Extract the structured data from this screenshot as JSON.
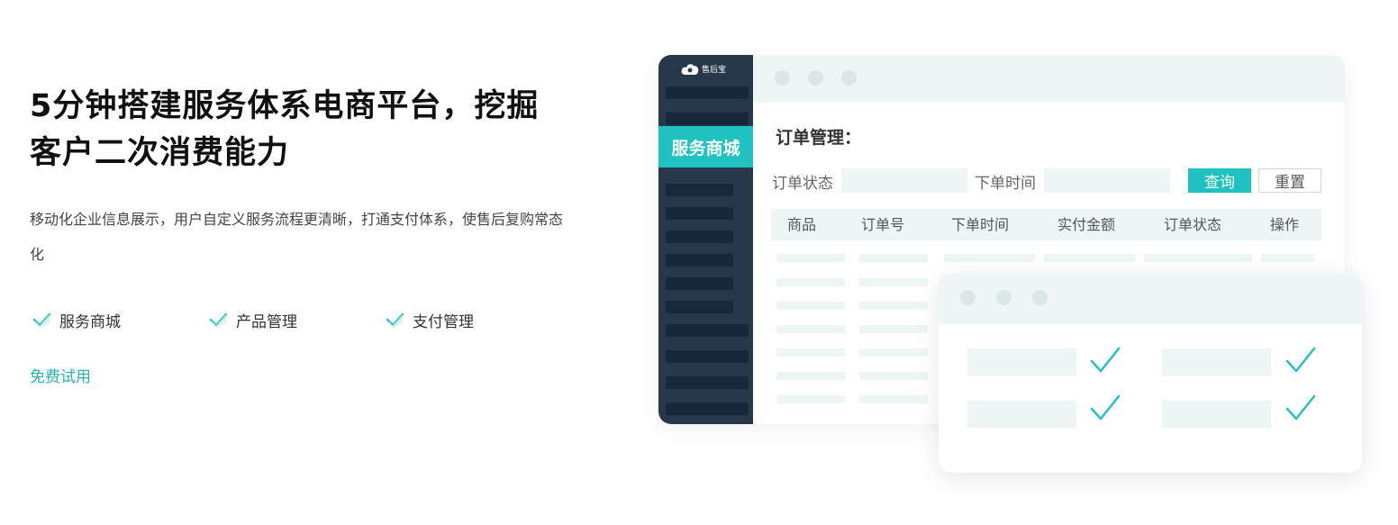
{
  "hero": {
    "title": "5分钟搭建服务体系电商平台，挖掘客户二次消费能力",
    "description": "移动化企业信息展示，用户自定义服务流程更清晰，打通支付体系，使售后复购常态化",
    "features": [
      "服务商城",
      "产品管理",
      "支付管理"
    ],
    "trial_link": "免费试用"
  },
  "mockup": {
    "logo_text": "售后宝",
    "active_menu": "服务商城",
    "heading": "订单管理：",
    "filters": {
      "status_label": "订单状态",
      "time_label": "下单时间",
      "query_button": "查询",
      "reset_button": "重置"
    },
    "table_headers": [
      "商品",
      "订单号",
      "下单时间",
      "实付金额",
      "订单状态",
      "操作"
    ]
  },
  "colors": {
    "accent": "#1fc1c1",
    "sidebar": "#27384a",
    "sidebar_bar": "#16293a",
    "placeholder": "#eef5f5",
    "check": "#2bbfc7"
  },
  "icons": {
    "feature": "check-icon",
    "card": "check-icon",
    "logo": "cloud-icon"
  }
}
